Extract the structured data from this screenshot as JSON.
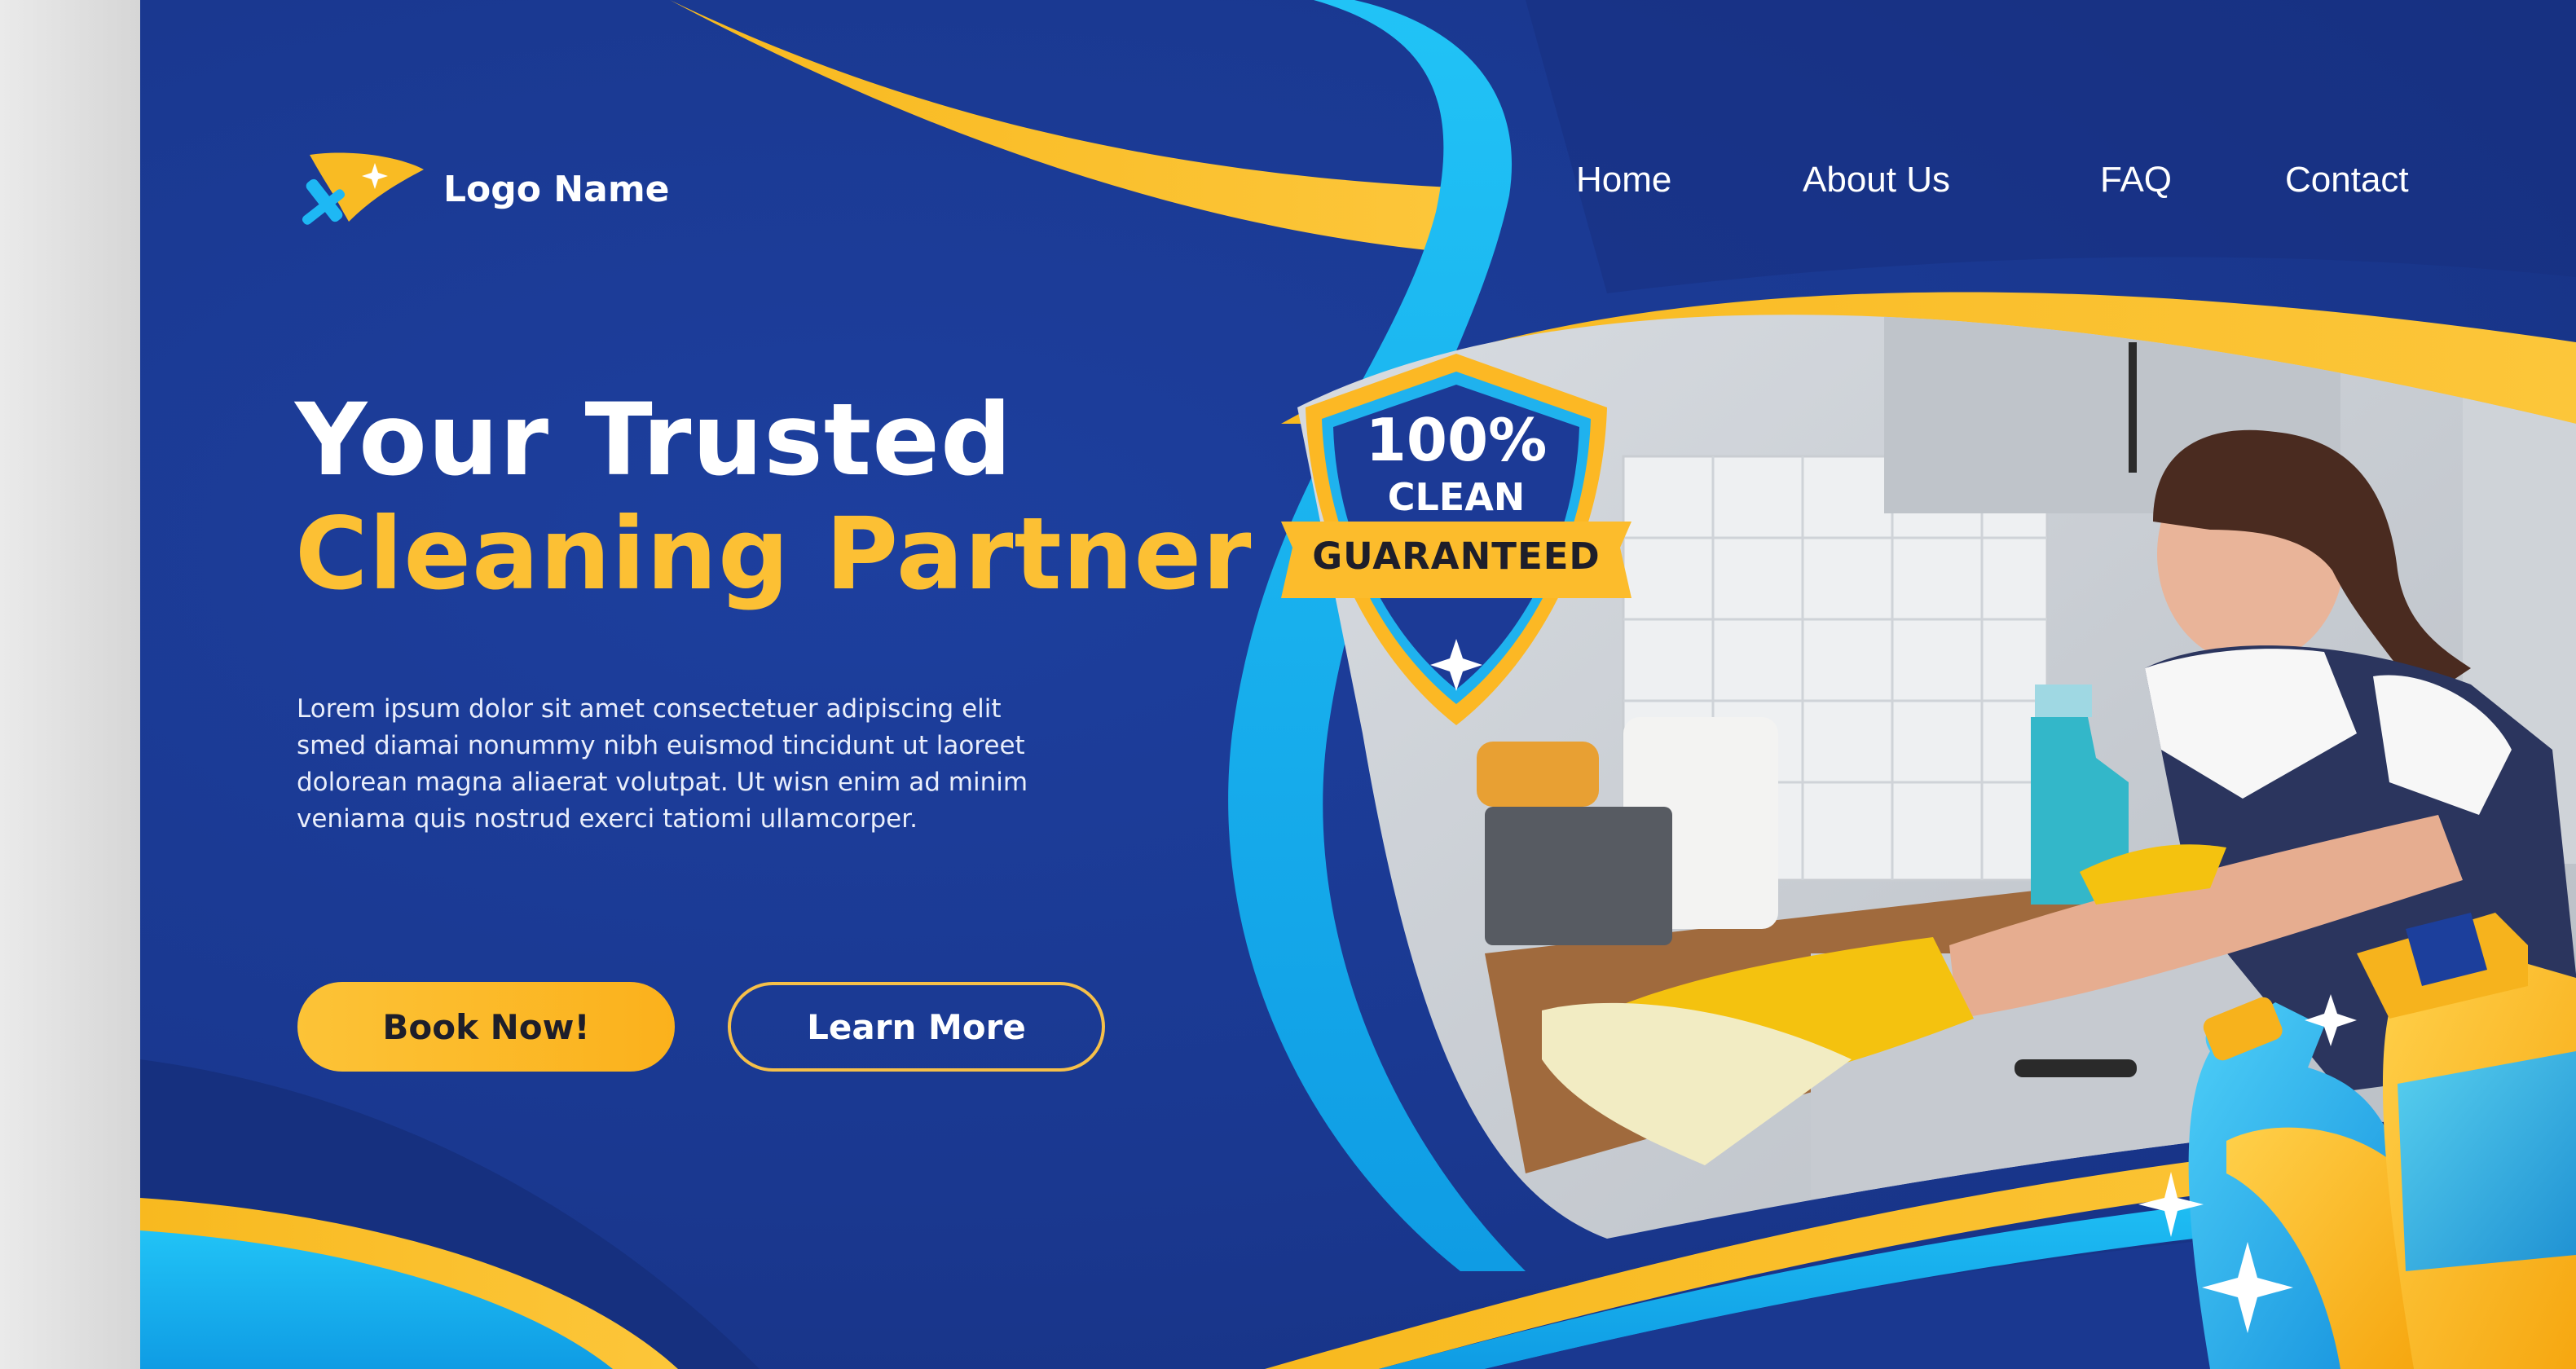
{
  "logo": {
    "name": "Logo Name",
    "icon": "squeegee-icon"
  },
  "nav": {
    "items": [
      {
        "label": "Home"
      },
      {
        "label": "About Us"
      },
      {
        "label": "FAQ"
      },
      {
        "label": "Contact"
      }
    ]
  },
  "hero": {
    "title_line1": "Your Trusted",
    "title_line2": "Cleaning Partner",
    "description": "Lorem ipsum dolor sit amet consectetuer adipiscing elit smed diamai nonummy nibh euismod tincidunt ut laoreet dolorean magna aliaerat volutpat. Ut wisn enim ad minim veniama quis nostrud exerci tatiomi ullamcorper.",
    "primary_button": "Book Now!",
    "secondary_button": "Learn More"
  },
  "badge": {
    "percent": "100%",
    "word": "CLEAN",
    "ribbon": "GUARANTEED",
    "icon": "sparkle-icon"
  },
  "colors": {
    "background": "#1b3a92",
    "accent_yellow": "#fcc034",
    "accent_cyan": "#19b3f0"
  }
}
